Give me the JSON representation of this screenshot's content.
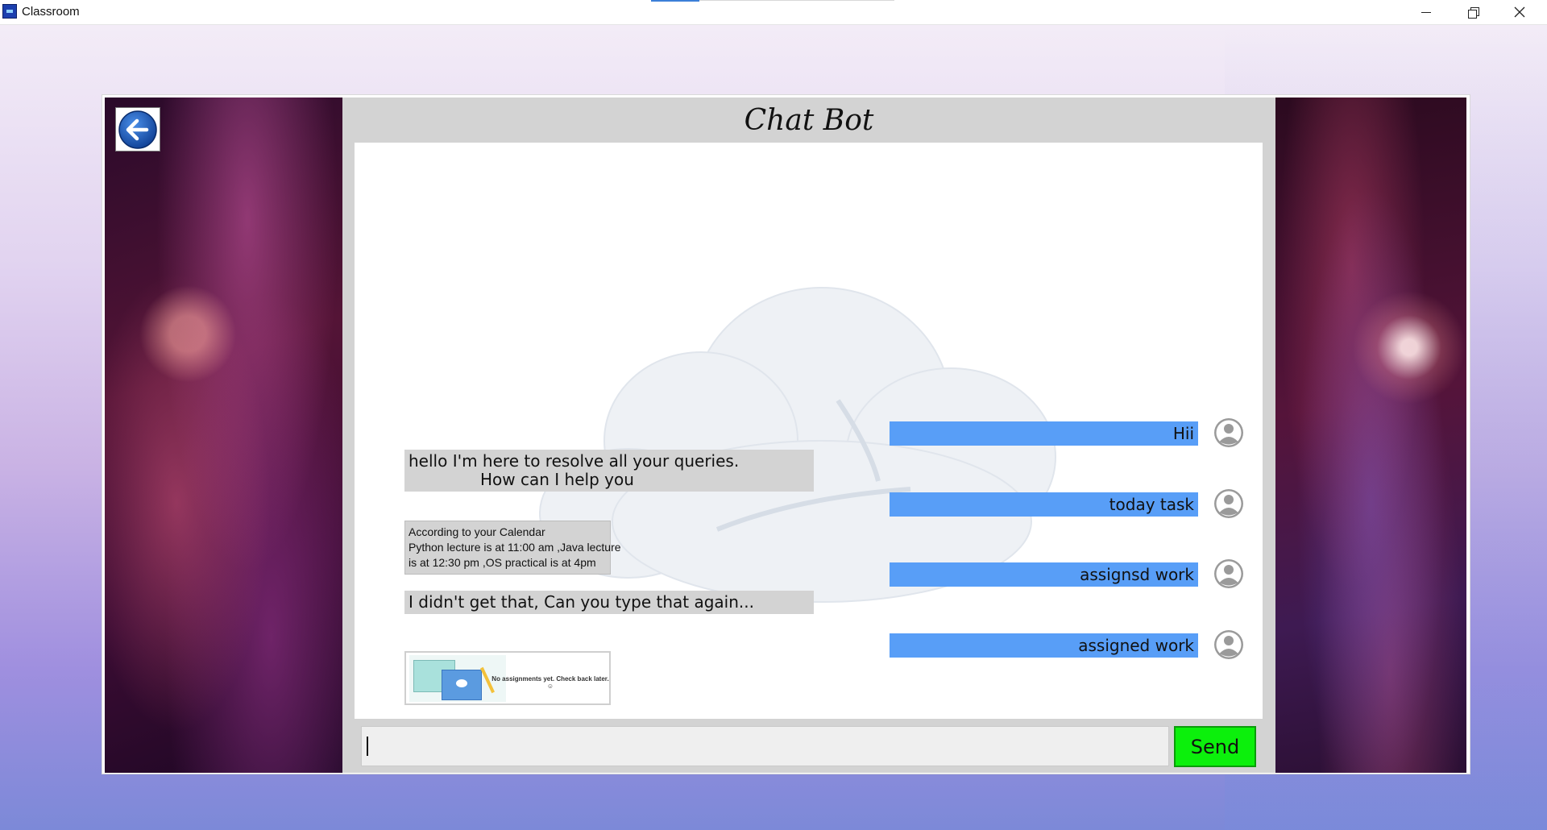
{
  "window": {
    "title": "Classroom",
    "minimize_icon": "minimize-icon",
    "maximize_icon": "restore-icon",
    "close_icon": "close-icon"
  },
  "colors": {
    "user_bubble": "#589ef7",
    "bot_bubble": "#d3d3d3",
    "send_button": "#0cf00c",
    "panel": "#d3d3d3"
  },
  "header": {
    "back_icon": "arrow-left-icon",
    "title": "Chat Bot"
  },
  "conversation": {
    "user_messages": [
      {
        "text": "Hii",
        "avatar_icon": "user-avatar-icon"
      },
      {
        "text": "today task",
        "avatar_icon": "user-avatar-icon"
      },
      {
        "text": "assignsd work",
        "avatar_icon": "user-avatar-icon"
      },
      {
        "text": "assigned work",
        "avatar_icon": "user-avatar-icon"
      }
    ],
    "bot_messages": [
      {
        "text": "hello I'm here to resolve all your queries.\n              How can I help you"
      },
      {
        "text": "According to your Calendar\nPython lecture is at 11:00 am ,Java lecture\nis at 12:30 pm ,OS practical is at 4pm"
      },
      {
        "text": "I didn't get that, Can you type that again..."
      }
    ],
    "bot_image": {
      "caption": "No assignments yet. Check back later. ☺"
    }
  },
  "composer": {
    "input_value": "",
    "input_placeholder": "",
    "send_label": "Send"
  }
}
